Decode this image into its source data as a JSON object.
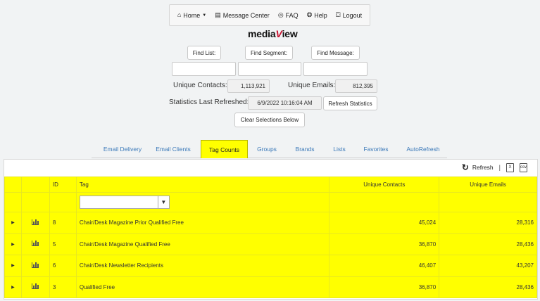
{
  "nav": {
    "items": [
      {
        "icon": "home-icon",
        "glyph": "⌂",
        "label": "Home",
        "dropdown": true
      },
      {
        "icon": "message-icon",
        "glyph": "▤",
        "label": "Message Center"
      },
      {
        "icon": "faq-icon",
        "glyph": "◎",
        "label": "FAQ"
      },
      {
        "icon": "help-icon",
        "glyph": "❂",
        "label": "Help"
      },
      {
        "icon": "logout-icon",
        "glyph": "⛋",
        "label": "Logout"
      }
    ]
  },
  "logo": {
    "part1": "media",
    "part2": "V",
    "part3": "iew"
  },
  "find": {
    "list": "Find List:",
    "segment": "Find Segment:",
    "message": "Find Message:"
  },
  "stats": {
    "unique_contacts_label": "Unique Contacts:",
    "unique_contacts_value": "1,113,921",
    "unique_emails_label": "Unique Emails:",
    "unique_emails_value": "812,395",
    "last_refreshed_label": "Statistics Last Refreshed:",
    "last_refreshed_value": "6/9/2022 10:16:04 AM",
    "refresh_button": "Refresh Statistics",
    "clear_button": "Clear Selections Below"
  },
  "tabs": [
    "Email Delivery",
    "Email Clients",
    "Tag Counts",
    "Groups",
    "Brands",
    "Lists",
    "Favorites",
    "AutoRefresh"
  ],
  "active_tab": "Tag Counts",
  "toolbar": {
    "refresh": "Refresh",
    "separator": "|",
    "excel": "X",
    "csv": "csv"
  },
  "table": {
    "columns": {
      "id": "ID",
      "tag": "Tag",
      "contacts": "Unique Contacts",
      "emails": "Unique Emails"
    },
    "rows": [
      {
        "id": "8",
        "tag": "Chair/Desk Magazine Prior Qualified Free",
        "contacts": "45,024",
        "emails": "28,316"
      },
      {
        "id": "5",
        "tag": "Chair/Desk Magazine Qualified Free",
        "contacts": "36,870",
        "emails": "28,436"
      },
      {
        "id": "6",
        "tag": "Chair/Desk Newsletter Recipients",
        "contacts": "46,407",
        "emails": "43,207"
      },
      {
        "id": "3",
        "tag": "Qualified Free",
        "contacts": "36,870",
        "emails": "28,436"
      }
    ]
  },
  "colors": {
    "highlight": "#ffff00",
    "tab_link": "#3a78b8",
    "logo_accent": "#c8102e"
  }
}
